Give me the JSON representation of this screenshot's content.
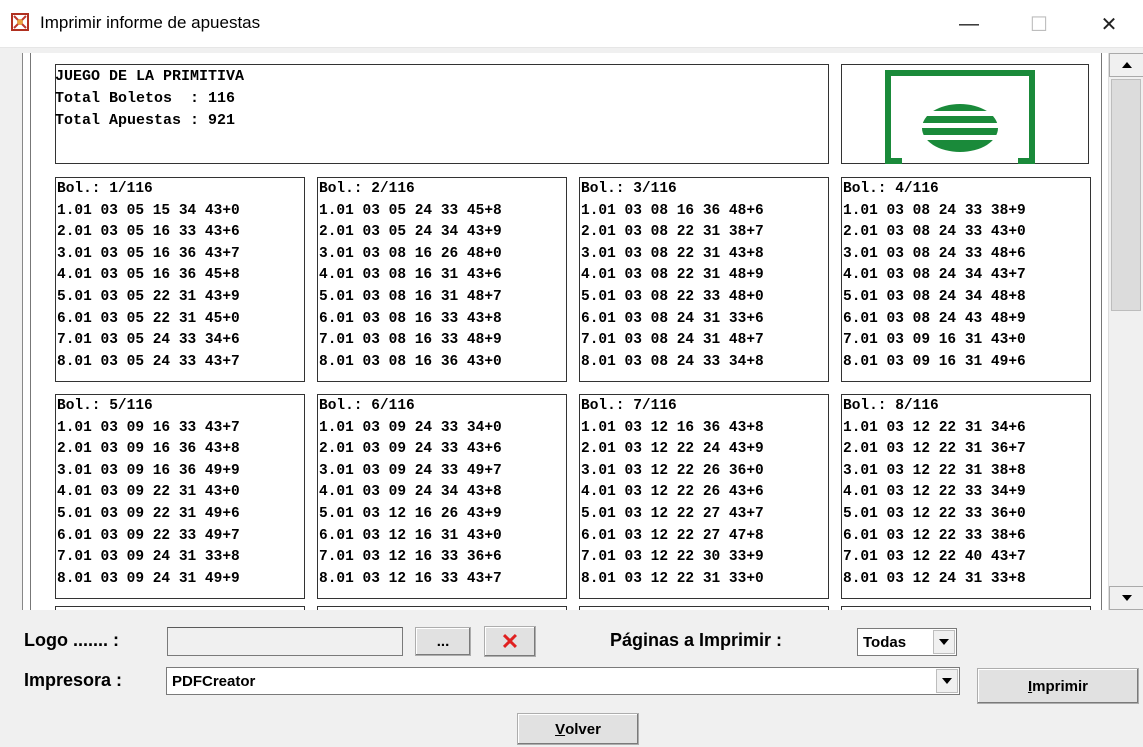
{
  "window": {
    "title": "Imprimir informe de apuestas",
    "minimize_glyph": "—",
    "maximize_glyph": "☐",
    "close_glyph": "✕"
  },
  "report": {
    "header_lines": [
      "JUEGO DE LA PRIMITIVA",
      "Total Boletos  : 116",
      "Total Apuestas : 921"
    ],
    "boletos": [
      {
        "title": "Bol.: 1/116",
        "lines": [
          "1.01 03 05 15 34 43+0",
          "2.01 03 05 16 33 43+6",
          "3.01 03 05 16 36 43+7",
          "4.01 03 05 16 36 45+8",
          "5.01 03 05 22 31 43+9",
          "6.01 03 05 22 31 45+0",
          "7.01 03 05 24 33 34+6",
          "8.01 03 05 24 33 43+7"
        ]
      },
      {
        "title": "Bol.: 2/116",
        "lines": [
          "1.01 03 05 24 33 45+8",
          "2.01 03 05 24 34 43+9",
          "3.01 03 08 16 26 48+0",
          "4.01 03 08 16 31 43+6",
          "5.01 03 08 16 31 48+7",
          "6.01 03 08 16 33 43+8",
          "7.01 03 08 16 33 48+9",
          "8.01 03 08 16 36 43+0"
        ]
      },
      {
        "title": "Bol.: 3/116",
        "lines": [
          "1.01 03 08 16 36 48+6",
          "2.01 03 08 22 31 38+7",
          "3.01 03 08 22 31 43+8",
          "4.01 03 08 22 31 48+9",
          "5.01 03 08 22 33 48+0",
          "6.01 03 08 24 31 33+6",
          "7.01 03 08 24 31 48+7",
          "8.01 03 08 24 33 34+8"
        ]
      },
      {
        "title": "Bol.: 4/116",
        "lines": [
          "1.01 03 08 24 33 38+9",
          "2.01 03 08 24 33 43+0",
          "3.01 03 08 24 33 48+6",
          "4.01 03 08 24 34 43+7",
          "5.01 03 08 24 34 48+8",
          "6.01 03 08 24 43 48+9",
          "7.01 03 09 16 31 43+0",
          "8.01 03 09 16 31 49+6"
        ]
      },
      {
        "title": "Bol.: 5/116",
        "lines": [
          "1.01 03 09 16 33 43+7",
          "2.01 03 09 16 36 43+8",
          "3.01 03 09 16 36 49+9",
          "4.01 03 09 22 31 43+0",
          "5.01 03 09 22 31 49+6",
          "6.01 03 09 22 33 49+7",
          "7.01 03 09 24 31 33+8",
          "8.01 03 09 24 31 49+9"
        ]
      },
      {
        "title": "Bol.: 6/116",
        "lines": [
          "1.01 03 09 24 33 34+0",
          "2.01 03 09 24 33 43+6",
          "3.01 03 09 24 33 49+7",
          "4.01 03 09 24 34 43+8",
          "5.01 03 12 16 26 43+9",
          "6.01 03 12 16 31 43+0",
          "7.01 03 12 16 33 36+6",
          "8.01 03 12 16 33 43+7"
        ]
      },
      {
        "title": "Bol.: 7/116",
        "lines": [
          "1.01 03 12 16 36 43+8",
          "2.01 03 12 22 24 43+9",
          "3.01 03 12 22 26 36+0",
          "4.01 03 12 22 26 43+6",
          "5.01 03 12 22 27 43+7",
          "6.01 03 12 22 27 47+8",
          "7.01 03 12 22 30 33+9",
          "8.01 03 12 22 31 33+0"
        ]
      },
      {
        "title": "Bol.: 8/116",
        "lines": [
          "1.01 03 12 22 31 34+6",
          "2.01 03 12 22 31 36+7",
          "3.01 03 12 22 31 38+8",
          "4.01 03 12 22 33 34+9",
          "5.01 03 12 22 33 36+0",
          "6.01 03 12 22 33 38+6",
          "7.01 03 12 22 40 43+7",
          "8.01 03 12 24 31 33+8"
        ]
      }
    ]
  },
  "controls": {
    "logo_label": "Logo ....... :",
    "logo_value": "",
    "browse_label": "...",
    "clear_glyph": "✕",
    "pages_label": "Páginas a Imprimir :",
    "pages_value": "Todas",
    "printer_label": "Impresora :",
    "printer_value": "PDFCreator",
    "print_label_first": "I",
    "print_label_rest": "mprimir",
    "back_label_first": "V",
    "back_label_rest": "olver"
  },
  "colors": {
    "logo_green": "#1a8a3a",
    "clear_red": "#e02020"
  },
  "icons": {
    "app": "app-icon",
    "scroll_up": "scroll-up-arrow-icon",
    "scroll_down": "scroll-down-arrow-icon",
    "dropdown": "chevron-down-icon"
  }
}
